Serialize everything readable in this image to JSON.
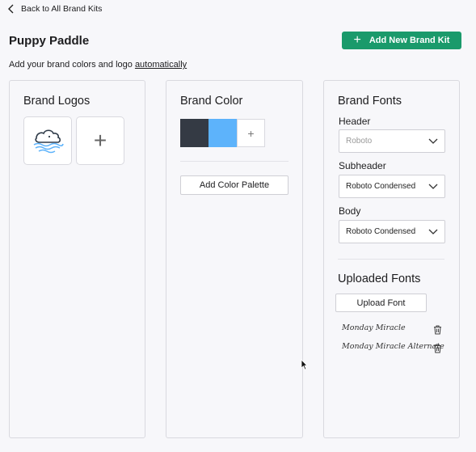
{
  "nav": {
    "back_label": "Back to All Brand Kits"
  },
  "header": {
    "title": "Puppy Paddle",
    "add_kit_label": "Add New Brand Kit",
    "subtitle_text": "Add your brand colors and logo ",
    "subtitle_link": "automatically"
  },
  "logos": {
    "title": "Brand Logos",
    "add_icon": "plus-icon"
  },
  "color": {
    "title": "Brand Color",
    "swatches": [
      "#343a44",
      "#5db3fb"
    ],
    "add_palette_label": "Add Color Palette"
  },
  "fonts": {
    "title": "Brand Fonts",
    "header_label": "Header",
    "header_value": "Roboto",
    "subheader_label": "Subheader",
    "subheader_value": "Roboto Condensed",
    "body_label": "Body",
    "body_value": "Roboto Condensed",
    "uploaded_title": "Uploaded Fonts",
    "upload_label": "Upload Font",
    "uploaded": [
      "Monday Miracle",
      "Monday Miracle Alternate"
    ]
  },
  "colors": {
    "accent": "#1a9a6b",
    "border": "#d9d9df"
  }
}
